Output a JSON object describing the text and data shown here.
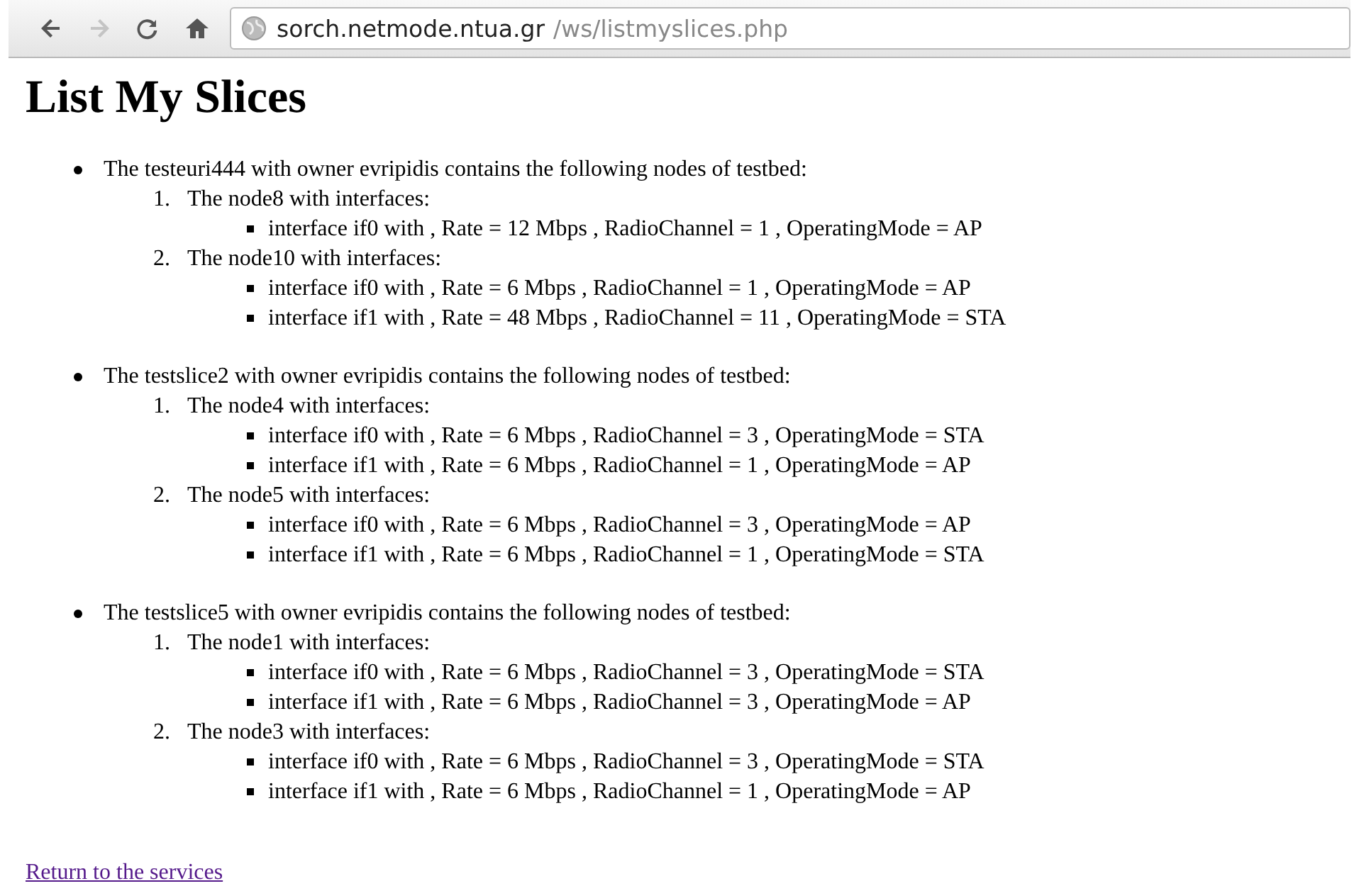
{
  "toolbar": {
    "buttons": [
      {
        "kind": "back",
        "disabled": false
      },
      {
        "kind": "forward",
        "disabled": true
      },
      {
        "kind": "reload",
        "disabled": false
      },
      {
        "kind": "home",
        "disabled": false
      }
    ],
    "address": {
      "host": "sorch.netmode.ntua.gr",
      "path": "/ws/listmyslices.php"
    }
  },
  "heading": "List My Slices",
  "slices": [
    {
      "text": "The testeuri444 with owner evripidis contains the following nodes of testbed:",
      "nodes": [
        {
          "number": "1.",
          "text": "The node8 with interfaces:",
          "interfaces": [
            "interface if0 with , Rate = 12 Mbps , RadioChannel = 1 , OperatingMode = AP"
          ]
        },
        {
          "number": "2.",
          "text": "The node10 with interfaces:",
          "interfaces": [
            "interface if0 with , Rate = 6 Mbps , RadioChannel = 1 , OperatingMode = AP",
            "interface if1 with , Rate = 48 Mbps , RadioChannel = 11 , OperatingMode = STA"
          ]
        }
      ]
    },
    {
      "text": "The testslice2 with owner evripidis contains the following nodes of testbed:",
      "nodes": [
        {
          "number": "1.",
          "text": "The node4 with interfaces:",
          "interfaces": [
            "interface if0 with , Rate = 6 Mbps , RadioChannel = 3 , OperatingMode = STA",
            "interface if1 with , Rate = 6 Mbps , RadioChannel = 1 , OperatingMode = AP"
          ]
        },
        {
          "number": "2.",
          "text": "The node5 with interfaces:",
          "interfaces": [
            "interface if0 with , Rate = 6 Mbps , RadioChannel = 3 , OperatingMode = AP",
            "interface if1 with , Rate = 6 Mbps , RadioChannel = 1 , OperatingMode = STA"
          ]
        }
      ]
    },
    {
      "text": "The testslice5 with owner evripidis contains the following nodes of testbed:",
      "nodes": [
        {
          "number": "1.",
          "text": "The node1 with interfaces:",
          "interfaces": [
            "interface if0 with , Rate = 6 Mbps , RadioChannel = 3 , OperatingMode = STA",
            "interface if1 with , Rate = 6 Mbps , RadioChannel = 3 , OperatingMode = AP"
          ]
        },
        {
          "number": "2.",
          "text": "The node3 with interfaces:",
          "interfaces": [
            "interface if0 with , Rate = 6 Mbps , RadioChannel = 3 , OperatingMode = STA",
            "interface if1 with , Rate = 6 Mbps , RadioChannel = 1 , OperatingMode = AP"
          ]
        }
      ]
    }
  ],
  "link": "Return to the services"
}
